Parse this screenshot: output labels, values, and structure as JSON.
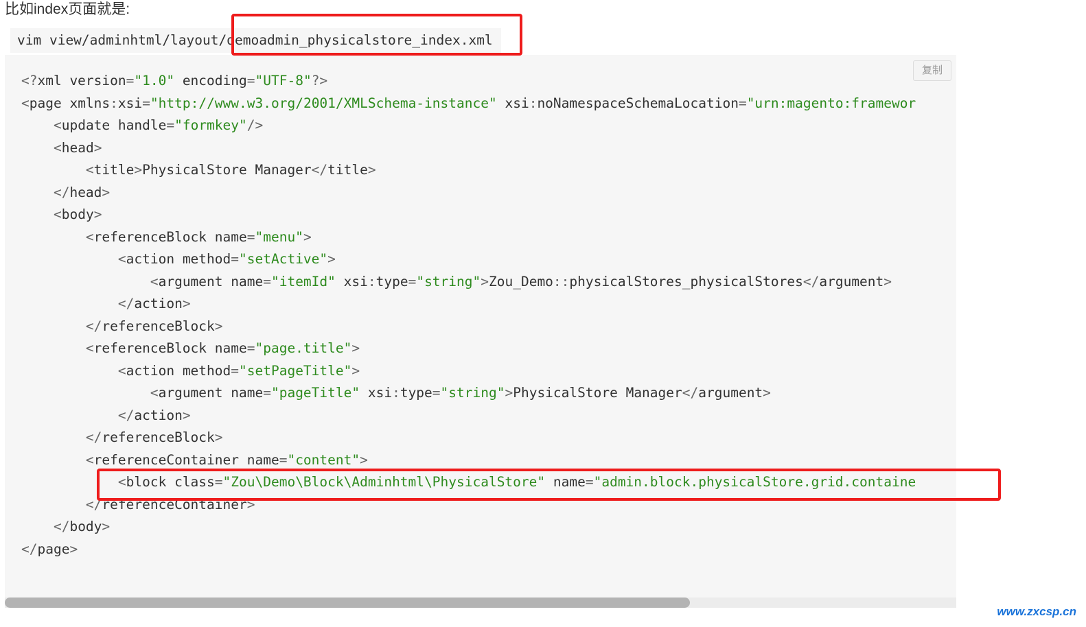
{
  "intro": "比如index页面就是:",
  "command": {
    "prefix": "vim view/adminhtml/layout/",
    "filename": "demoadmin_physicalstore_index.xml"
  },
  "copy_button": "复制",
  "code_lines": [
    [
      [
        "p",
        "<?"
      ],
      [
        "t",
        "xml version"
      ],
      [
        "p",
        "="
      ],
      [
        "s",
        "\"1.0\""
      ],
      [
        "t",
        " encoding"
      ],
      [
        "p",
        "="
      ],
      [
        "s",
        "\"UTF-8\""
      ],
      [
        "p",
        "?>"
      ]
    ],
    [
      [
        "p",
        "<"
      ],
      [
        "t",
        "page xmlns"
      ],
      [
        "p",
        ":"
      ],
      [
        "t",
        "xsi"
      ],
      [
        "p",
        "="
      ],
      [
        "s",
        "\"http://www.w3.org/2001/XMLSchema-instance\""
      ],
      [
        "t",
        " xsi"
      ],
      [
        "p",
        ":"
      ],
      [
        "t",
        "noNamespaceSchemaLocation"
      ],
      [
        "p",
        "="
      ],
      [
        "s",
        "\"urn:magento:framewor"
      ]
    ],
    [
      [
        "t",
        "    "
      ],
      [
        "p",
        "<"
      ],
      [
        "t",
        "update handle"
      ],
      [
        "p",
        "="
      ],
      [
        "s",
        "\"formkey\""
      ],
      [
        "p",
        "/>"
      ]
    ],
    [
      [
        "t",
        "    "
      ],
      [
        "p",
        "<"
      ],
      [
        "t",
        "head"
      ],
      [
        "p",
        ">"
      ]
    ],
    [
      [
        "t",
        "        "
      ],
      [
        "p",
        "<"
      ],
      [
        "t",
        "title"
      ],
      [
        "p",
        ">"
      ],
      [
        "t",
        "PhysicalStore Manager"
      ],
      [
        "p",
        "</"
      ],
      [
        "t",
        "title"
      ],
      [
        "p",
        ">"
      ]
    ],
    [
      [
        "t",
        "    "
      ],
      [
        "p",
        "</"
      ],
      [
        "t",
        "head"
      ],
      [
        "p",
        ">"
      ]
    ],
    [
      [
        "t",
        "    "
      ],
      [
        "p",
        "<"
      ],
      [
        "t",
        "body"
      ],
      [
        "p",
        ">"
      ]
    ],
    [
      [
        "t",
        "        "
      ],
      [
        "p",
        "<"
      ],
      [
        "t",
        "referenceBlock name"
      ],
      [
        "p",
        "="
      ],
      [
        "s",
        "\"menu\""
      ],
      [
        "p",
        ">"
      ]
    ],
    [
      [
        "t",
        "            "
      ],
      [
        "p",
        "<"
      ],
      [
        "t",
        "action method"
      ],
      [
        "p",
        "="
      ],
      [
        "s",
        "\"setActive\""
      ],
      [
        "p",
        ">"
      ]
    ],
    [
      [
        "t",
        "                "
      ],
      [
        "p",
        "<"
      ],
      [
        "t",
        "argument name"
      ],
      [
        "p",
        "="
      ],
      [
        "s",
        "\"itemId\""
      ],
      [
        "t",
        " xsi"
      ],
      [
        "p",
        ":"
      ],
      [
        "t",
        "type"
      ],
      [
        "p",
        "="
      ],
      [
        "s",
        "\"string\""
      ],
      [
        "p",
        ">"
      ],
      [
        "t",
        "Zou_Demo"
      ],
      [
        "p",
        "::"
      ],
      [
        "t",
        "physicalStores_physicalStores"
      ],
      [
        "p",
        "</"
      ],
      [
        "t",
        "argument"
      ],
      [
        "p",
        ">"
      ]
    ],
    [
      [
        "t",
        "            "
      ],
      [
        "p",
        "</"
      ],
      [
        "t",
        "action"
      ],
      [
        "p",
        ">"
      ]
    ],
    [
      [
        "t",
        "        "
      ],
      [
        "p",
        "</"
      ],
      [
        "t",
        "referenceBlock"
      ],
      [
        "p",
        ">"
      ]
    ],
    [
      [
        "t",
        "        "
      ],
      [
        "p",
        "<"
      ],
      [
        "t",
        "referenceBlock name"
      ],
      [
        "p",
        "="
      ],
      [
        "s",
        "\"page.title\""
      ],
      [
        "p",
        ">"
      ]
    ],
    [
      [
        "t",
        "            "
      ],
      [
        "p",
        "<"
      ],
      [
        "t",
        "action method"
      ],
      [
        "p",
        "="
      ],
      [
        "s",
        "\"setPageTitle\""
      ],
      [
        "p",
        ">"
      ]
    ],
    [
      [
        "t",
        "                "
      ],
      [
        "p",
        "<"
      ],
      [
        "t",
        "argument name"
      ],
      [
        "p",
        "="
      ],
      [
        "s",
        "\"pageTitle\""
      ],
      [
        "t",
        " xsi"
      ],
      [
        "p",
        ":"
      ],
      [
        "t",
        "type"
      ],
      [
        "p",
        "="
      ],
      [
        "s",
        "\"string\""
      ],
      [
        "p",
        ">"
      ],
      [
        "t",
        "PhysicalStore Manager"
      ],
      [
        "p",
        "</"
      ],
      [
        "t",
        "argument"
      ],
      [
        "p",
        ">"
      ]
    ],
    [
      [
        "t",
        "            "
      ],
      [
        "p",
        "</"
      ],
      [
        "t",
        "action"
      ],
      [
        "p",
        ">"
      ]
    ],
    [
      [
        "t",
        "        "
      ],
      [
        "p",
        "</"
      ],
      [
        "t",
        "referenceBlock"
      ],
      [
        "p",
        ">"
      ]
    ],
    [
      [
        "t",
        "        "
      ],
      [
        "p",
        "<"
      ],
      [
        "t",
        "referenceContainer name"
      ],
      [
        "p",
        "="
      ],
      [
        "s",
        "\"content\""
      ],
      [
        "p",
        ">"
      ]
    ],
    [
      [
        "t",
        "            "
      ],
      [
        "p",
        "<"
      ],
      [
        "t",
        "block class"
      ],
      [
        "p",
        "="
      ],
      [
        "s",
        "\"Zou\\Demo\\Block\\Adminhtml\\PhysicalStore\""
      ],
      [
        "t",
        " name"
      ],
      [
        "p",
        "="
      ],
      [
        "s",
        "\"admin.block.physicalStore.grid.containe"
      ]
    ],
    [
      [
        "t",
        "        "
      ],
      [
        "p",
        "</"
      ],
      [
        "t",
        "referenceContainer"
      ],
      [
        "p",
        ">"
      ]
    ],
    [
      [
        "t",
        "    "
      ],
      [
        "p",
        "</"
      ],
      [
        "t",
        "body"
      ],
      [
        "p",
        ">"
      ]
    ],
    [
      [
        "p",
        "</"
      ],
      [
        "t",
        "page"
      ],
      [
        "p",
        ">"
      ]
    ]
  ],
  "watermark": "www.zxcsp.cn",
  "colors": {
    "highlight_box": "#ee1c1c",
    "string": "#2e8b1e",
    "punctuation": "#666666",
    "text": "#333333",
    "code_background": "#f6f6f6",
    "watermark": "#1a73d9"
  }
}
